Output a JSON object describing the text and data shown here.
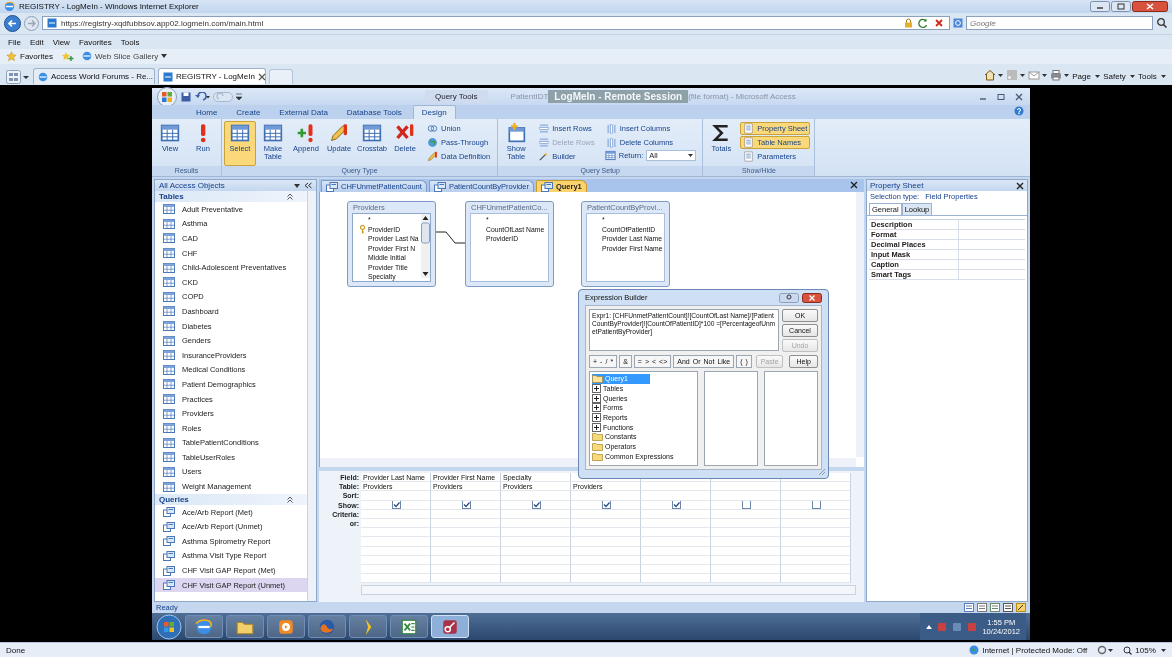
{
  "browser": {
    "title": "REGISTRY - LogMeIn - Windows Internet Explorer",
    "address": "https://registry-xqdfubbsov.app02.logmein.com/main.html",
    "search": {
      "placeholder": "Google"
    },
    "menu": [
      "File",
      "Edit",
      "View",
      "Favorites",
      "Tools"
    ],
    "favorites": {
      "label": "Favorites",
      "links": [
        "Web Slice Gallery"
      ]
    },
    "tabs": [
      {
        "label": "Access World Forums - Re...",
        "selected": false
      },
      {
        "label": "REGISTRY - LogMeIn",
        "selected": true
      }
    ],
    "commands": [
      "Page",
      "Safety",
      "Tools"
    ],
    "status": {
      "text": "Done",
      "zone": "Internet | Protected Mode: Off",
      "zoom": "105%"
    }
  },
  "remote": {
    "overlay": "LogMeIn - Remote Session"
  },
  "access": {
    "title_start": "PatientIDT",
    "title_end": "(file format) - Microsoft Access",
    "context_label": "Query Tools",
    "ribbon_tabs": [
      {
        "label": "Home",
        "selected": false
      },
      {
        "label": "Create",
        "selected": false
      },
      {
        "label": "External Data",
        "selected": false
      },
      {
        "label": "Database Tools",
        "selected": false
      },
      {
        "label": "Design",
        "selected": true
      }
    ],
    "ribbon_groups": [
      {
        "label": "Results",
        "items": [
          {
            "kind": "large",
            "label": "View",
            "selected": false,
            "disabled": false
          },
          {
            "kind": "large",
            "label": "Run",
            "selected": false,
            "disabled": false
          }
        ]
      },
      {
        "label": "Query Type",
        "items": [
          {
            "kind": "large",
            "label": "Select",
            "selected": true,
            "disabled": false
          },
          {
            "kind": "large",
            "label": "Make Table",
            "selected": false,
            "disabled": false
          },
          {
            "kind": "large",
            "label": "Append",
            "selected": false,
            "disabled": false
          },
          {
            "kind": "large",
            "label": "Update",
            "selected": false,
            "disabled": false
          },
          {
            "kind": "large",
            "label": "Crosstab",
            "selected": false,
            "disabled": false
          },
          {
            "kind": "large",
            "label": "Delete",
            "selected": false,
            "disabled": false
          },
          {
            "kind": "small",
            "label": "Union",
            "selected": false,
            "disabled": false
          },
          {
            "kind": "small",
            "label": "Pass-Through",
            "selected": false,
            "disabled": false
          },
          {
            "kind": "small",
            "label": "Data Definition",
            "selected": false,
            "disabled": false
          }
        ]
      },
      {
        "label": "Query Setup",
        "items": [
          {
            "kind": "large",
            "label": "Show Table",
            "selected": false,
            "disabled": false
          },
          {
            "kind": "small",
            "label": "Insert Rows",
            "selected": false,
            "disabled": false
          },
          {
            "kind": "small",
            "label": "Delete Rows",
            "selected": false,
            "disabled": true
          },
          {
            "kind": "small",
            "label": "Builder",
            "selected": false,
            "disabled": false
          },
          {
            "kind": "small",
            "label": "Insert Columns",
            "selected": false,
            "disabled": false
          },
          {
            "kind": "small",
            "label": "Delete Columns",
            "selected": false,
            "disabled": false
          },
          {
            "kind": "combo",
            "label": "Return:",
            "value": "All",
            "selected": false,
            "disabled": false
          }
        ]
      },
      {
        "label": "Show/Hide",
        "items": [
          {
            "kind": "large",
            "label": "Totals",
            "selected": false,
            "disabled": false
          },
          {
            "kind": "small",
            "label": "Property Sheet",
            "selected": true,
            "disabled": false
          },
          {
            "kind": "small",
            "label": "Table Names",
            "selected": true,
            "disabled": false
          },
          {
            "kind": "small",
            "label": "Parameters",
            "selected": false,
            "disabled": false
          }
        ]
      }
    ],
    "nav": {
      "title": "All Access Objects",
      "groups": [
        {
          "title": "Tables",
          "kind": "table",
          "items": [
            {
              "label": "Adult Preventative",
              "selected": false
            },
            {
              "label": "Asthma",
              "selected": false
            },
            {
              "label": "CAD",
              "selected": false
            },
            {
              "label": "CHF",
              "selected": false
            },
            {
              "label": "Child-Adolescent Preventatives",
              "selected": false
            },
            {
              "label": "CKD",
              "selected": false
            },
            {
              "label": "COPD",
              "selected": false
            },
            {
              "label": "Dashboard",
              "selected": false
            },
            {
              "label": "Diabetes",
              "selected": false
            },
            {
              "label": "Genders",
              "selected": false
            },
            {
              "label": "InsuranceProviders",
              "selected": false
            },
            {
              "label": "Medical Conditions",
              "selected": false
            },
            {
              "label": "Patient Demographics",
              "selected": false
            },
            {
              "label": "Practices",
              "selected": false
            },
            {
              "label": "Providers",
              "selected": false
            },
            {
              "label": "Roles",
              "selected": false
            },
            {
              "label": "TablePatientConditions",
              "selected": false
            },
            {
              "label": "TableUserRoles",
              "selected": false
            },
            {
              "label": "Users",
              "selected": false
            },
            {
              "label": "Weight Management",
              "selected": false
            }
          ]
        },
        {
          "title": "Queries",
          "kind": "query",
          "items": [
            {
              "label": "Ace/Arb Report (Met)",
              "selected": false
            },
            {
              "label": "Ace/Arb Report (Unmet)",
              "selected": false
            },
            {
              "label": "Asthma Spirometry Report",
              "selected": false
            },
            {
              "label": "Asthma Visit Type Report",
              "selected": false
            },
            {
              "label": "CHF Visit GAP Report (Met)",
              "selected": false
            },
            {
              "label": "CHF Visit GAP Report (Unmet)",
              "selected": true
            }
          ]
        }
      ]
    },
    "doc_tabs": [
      {
        "label": "CHFUnmetPatientCount",
        "selected": false
      },
      {
        "label": "PatientCountByProvider",
        "selected": false
      },
      {
        "label": "Query1",
        "selected": true
      }
    ],
    "tables": [
      {
        "title": "Providers",
        "kind": "scrolling",
        "fields": [
          {
            "label": "*",
            "key": false
          },
          {
            "label": "ProviderID",
            "key": true
          },
          {
            "label": "Provider Last Na",
            "key": false
          },
          {
            "label": "Provider First N",
            "key": false
          },
          {
            "label": "Middle Initial",
            "key": false
          },
          {
            "label": "Provider Title",
            "key": false
          },
          {
            "label": "Specialty",
            "key": false
          }
        ]
      },
      {
        "title": "CHFUnmetPatientCo...",
        "kind": "plain",
        "fields": [
          {
            "label": "*",
            "key": false
          },
          {
            "label": "CountOfLast Name",
            "key": false
          },
          {
            "label": "ProviderID",
            "key": false
          }
        ]
      },
      {
        "title": "PatientCountByProvi...",
        "kind": "plain",
        "fields": [
          {
            "label": "*",
            "key": false
          },
          {
            "label": "CountOfPatientID",
            "key": false
          },
          {
            "label": "Provider Last Name",
            "key": false
          },
          {
            "label": "Provider First Name",
            "key": false
          }
        ]
      }
    ],
    "grid": {
      "row_labels": [
        "Field:",
        "Table:",
        "Sort:",
        "Show:",
        "Criteria:",
        "or:"
      ],
      "columns": [
        {
          "field": "Provider Last Name",
          "table": "Providers",
          "show": true
        },
        {
          "field": "Provider First Name",
          "table": "Providers",
          "show": true
        },
        {
          "field": "Specialty",
          "table": "Providers",
          "show": true
        },
        {
          "table": "Providers",
          "show": true
        },
        {
          "show": true
        },
        {
          "show": false
        },
        {
          "show": false
        }
      ]
    },
    "property_sheet": {
      "title": "Property Sheet",
      "selection_label": "Selection type:",
      "selection_value": "Field Properties",
      "tabs": [
        {
          "label": "General",
          "selected": true
        },
        {
          "label": "Lookup",
          "selected": false
        }
      ],
      "properties": [
        "Description",
        "Format",
        "Decimal Places",
        "Input Mask",
        "Caption",
        "Smart Tags"
      ]
    },
    "status": "Ready"
  },
  "dialog": {
    "title": "Expression Builder",
    "expression": "Expr1: [CHFUnmetPatientCount]![CountOfLast Name]/[PatientCountByProvider]![CountOfPatientID]*100 =[PercentageofUnmetPatientByProvider]",
    "buttons": [
      {
        "label": "OK",
        "disabled": false
      },
      {
        "label": "Cancel",
        "disabled": false
      },
      {
        "label": "Undo",
        "disabled": true
      }
    ],
    "operators": [
      [
        "+",
        "-",
        "/",
        "*"
      ],
      [
        "&"
      ],
      [
        "=",
        ">",
        "<",
        "<>"
      ],
      [
        "And",
        "Or",
        "Not",
        "Like"
      ],
      [
        "(",
        ")"
      ]
    ],
    "paste": {
      "label": "Paste",
      "disabled": true
    },
    "help": "Help",
    "tree": [
      {
        "label": "Query1",
        "expandable": false,
        "selected": true
      },
      {
        "label": "Tables",
        "expandable": true,
        "selected": false
      },
      {
        "label": "Queries",
        "expandable": true,
        "selected": false
      },
      {
        "label": "Forms",
        "expandable": true,
        "selected": false
      },
      {
        "label": "Reports",
        "expandable": true,
        "selected": false
      },
      {
        "label": "Functions",
        "expandable": true,
        "selected": false
      },
      {
        "label": "Constants",
        "expandable": false,
        "selected": false
      },
      {
        "label": "Operators",
        "expandable": false,
        "selected": false
      },
      {
        "label": "Common Expressions",
        "expandable": false,
        "selected": false
      }
    ]
  },
  "taskbar": {
    "apps": [
      {
        "selected": false
      },
      {
        "selected": false
      },
      {
        "selected": false
      },
      {
        "selected": false
      },
      {
        "selected": false
      },
      {
        "selected": false
      },
      {
        "selected": true
      }
    ],
    "time": "1:55 PM",
    "date": "10/24/2012"
  }
}
